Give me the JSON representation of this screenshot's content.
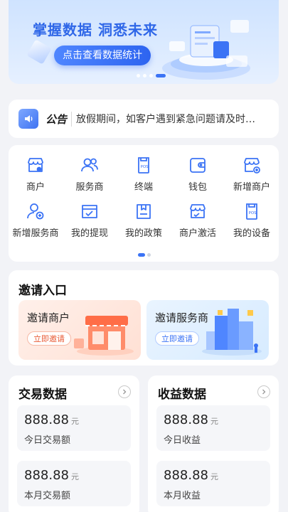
{
  "banner": {
    "title": "掌握数据 洞悉未来",
    "button_label": "点击查看数据统计",
    "dots_count": 4,
    "active_dot": 3
  },
  "notice": {
    "tag": "公告",
    "text": "放假期间，如客户遇到紧急问题请及时…"
  },
  "menu": {
    "items": [
      {
        "label": "商户",
        "icon": "shop-icon"
      },
      {
        "label": "服务商",
        "icon": "users-icon"
      },
      {
        "label": "终端",
        "icon": "pos-terminal-icon"
      },
      {
        "label": "钱包",
        "icon": "wallet-icon"
      },
      {
        "label": "新增商户",
        "icon": "add-shop-icon"
      },
      {
        "label": "新增服务商",
        "icon": "add-user-icon"
      },
      {
        "label": "我的提现",
        "icon": "withdraw-icon"
      },
      {
        "label": "我的政策",
        "icon": "policy-book-icon"
      },
      {
        "label": "商户激活",
        "icon": "shop-activate-icon"
      },
      {
        "label": "我的设备",
        "icon": "device-icon"
      }
    ],
    "page_count": 2,
    "active_page": 0
  },
  "invite": {
    "title": "邀请入口",
    "merchant": {
      "title": "邀请商户",
      "button": "立即邀请"
    },
    "provider": {
      "title": "邀请服务商",
      "button": "立即邀请"
    }
  },
  "trade": {
    "title": "交易数据",
    "today_value": "888.88",
    "today_unit": "元",
    "today_label": "今日交易额",
    "month_value": "888.88",
    "month_unit": "元",
    "month_label": "本月交易额"
  },
  "income": {
    "title": "收益数据",
    "today_value": "888.88",
    "today_unit": "元",
    "today_label": "今日收益",
    "month_value": "888.88",
    "month_unit": "元",
    "month_label": "本月收益"
  },
  "colors": {
    "accent": "#3b73f5",
    "icon_stroke": "#3b73f5",
    "merchant_accent": "#e85a35"
  }
}
